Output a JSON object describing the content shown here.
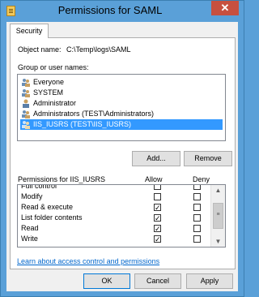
{
  "window": {
    "title": "Permissions for SAML",
    "close_glyph": "✕"
  },
  "tabs": [
    {
      "label": "Security"
    }
  ],
  "object": {
    "label": "Object name:",
    "value": "C:\\Temp\\logs\\SAML"
  },
  "groups": {
    "label": "Group or user names:",
    "items": [
      {
        "name": "Everyone",
        "icon": "users-group-icon"
      },
      {
        "name": "SYSTEM",
        "icon": "users-group-icon"
      },
      {
        "name": "Administrator",
        "icon": "user-icon"
      },
      {
        "name": "Administrators (TEST\\Administrators)",
        "icon": "users-group-icon"
      },
      {
        "name": "IIS_IUSRS (TEST\\IIS_IUSRS)",
        "icon": "users-group-icon",
        "selected": true
      }
    ]
  },
  "buttons": {
    "add": "Add...",
    "remove": "Remove",
    "ok": "OK",
    "cancel": "Cancel",
    "apply": "Apply"
  },
  "permissions": {
    "label": "Permissions for IIS_IUSRS",
    "allow_header": "Allow",
    "deny_header": "Deny",
    "rows": [
      {
        "name": "Full control",
        "allow": false,
        "deny": false
      },
      {
        "name": "Modify",
        "allow": false,
        "deny": false
      },
      {
        "name": "Read & execute",
        "allow": true,
        "deny": false
      },
      {
        "name": "List folder contents",
        "allow": true,
        "deny": false
      },
      {
        "name": "Read",
        "allow": true,
        "deny": false
      },
      {
        "name": "Write",
        "allow": true,
        "deny": false
      }
    ]
  },
  "link": "Learn about access control and permissions",
  "colors": {
    "title_bg": "#5aa0d8",
    "selection": "#3399ff",
    "close": "#c7503f",
    "link": "#0066cc"
  }
}
